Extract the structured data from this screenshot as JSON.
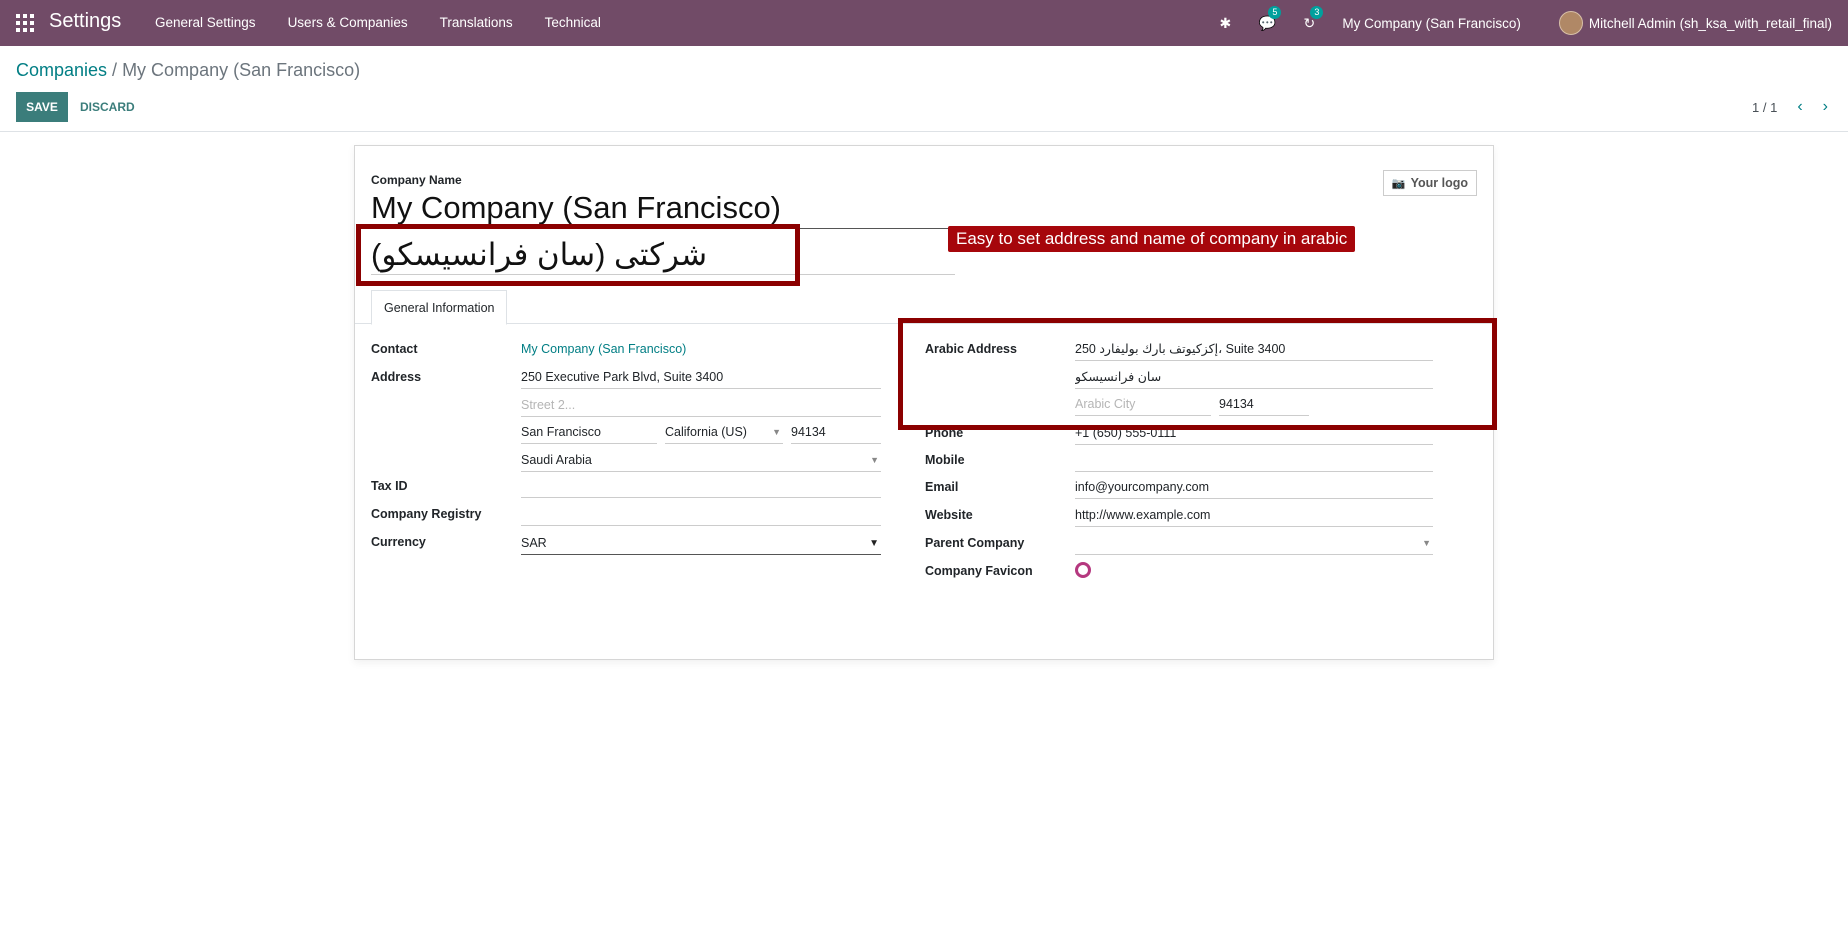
{
  "topbar": {
    "app_title": "Settings",
    "menu": [
      "General Settings",
      "Users & Companies",
      "Translations",
      "Technical"
    ],
    "chat_badge": "5",
    "activity_badge": "3",
    "company_switch": "My Company (San Francisco)",
    "user": "Mitchell Admin (sh_ksa_with_retail_final)",
    "bg_color": "#714b67"
  },
  "control_panel": {
    "breadcrumb_parent": "Companies",
    "breadcrumb_sep": " / ",
    "breadcrumb_current": "My Company (San Francisco)",
    "save_label": "SAVE",
    "discard_label": "DISCARD",
    "pager": "1 / 1"
  },
  "form": {
    "company_name_label": "Company Name",
    "company_name": "My Company (San Francisco)",
    "arabic_name": "شرکتی (سان فرانسیسکو)",
    "logo_label": "Your logo",
    "tab_general": "General Information",
    "left": {
      "contact_label": "Contact",
      "contact_value": "My Company (San Francisco)",
      "address_label": "Address",
      "street": "250 Executive Park Blvd, Suite 3400",
      "street2_placeholder": "Street 2...",
      "city": "San Francisco",
      "state": "California (US)",
      "zip": "94134",
      "country": "Saudi Arabia",
      "tax_id_label": "Tax ID",
      "tax_id_value": "",
      "registry_label": "Company Registry",
      "registry_value": "",
      "currency_label": "Currency",
      "currency_value": "SAR"
    },
    "right": {
      "arabic_address_label": "Arabic Address",
      "arabic_street": "250 إكزكيوتف بارك بوليفارد، Suite 3400",
      "arabic_street2": "سان فرانسيسكو",
      "arabic_city_placeholder": "Arabic City",
      "arabic_zip": "94134",
      "phone_label": "Phone",
      "phone_value": "+1 (650) 555-0111",
      "mobile_label": "Mobile",
      "mobile_value": "",
      "email_label": "Email",
      "email_value": "info@yourcompany.com",
      "website_label": "Website",
      "website_value": "http://www.example.com",
      "parent_label": "Parent Company",
      "parent_value": "",
      "favicon_label": "Company Favicon"
    }
  },
  "annotation": {
    "text": "Easy to set address and name of company in arabic",
    "color": "#a6060b"
  }
}
